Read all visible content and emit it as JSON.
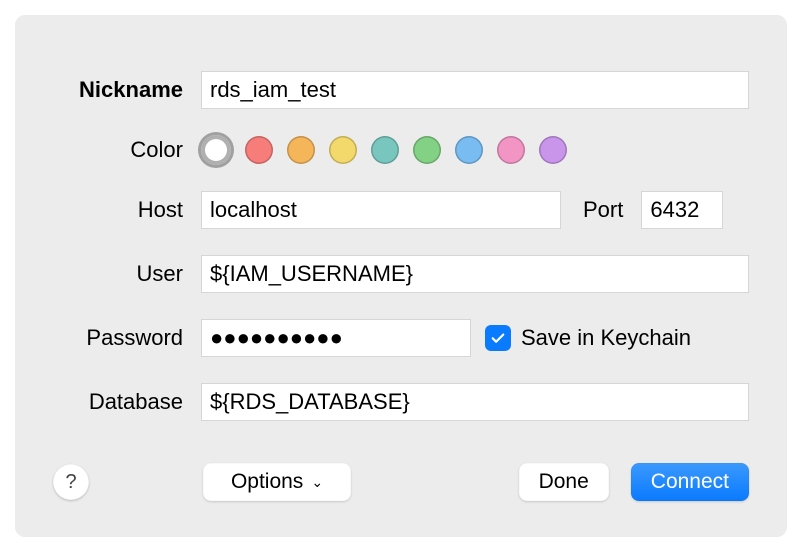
{
  "labels": {
    "nickname": "Nickname",
    "color": "Color",
    "host": "Host",
    "port": "Port",
    "user": "User",
    "password": "Password",
    "database": "Database",
    "saveKeychain": "Save in Keychain"
  },
  "values": {
    "nickname": "rds_iam_test",
    "host": "localhost",
    "port": "6432",
    "user": "${IAM_USERNAME}",
    "password": "●●●●●●●●●●",
    "database": "${RDS_DATABASE}"
  },
  "colors": {
    "swatches": [
      "#b0b0b0",
      "#f67d7a",
      "#f5b65a",
      "#f3d96b",
      "#79c6be",
      "#83d184",
      "#78bcf2",
      "#f295c4",
      "#c995ea"
    ],
    "selectedIndex": 0
  },
  "buttons": {
    "help": "?",
    "options": "Options",
    "done": "Done",
    "connect": "Connect"
  },
  "checkbox": {
    "saveKeychain": true
  }
}
